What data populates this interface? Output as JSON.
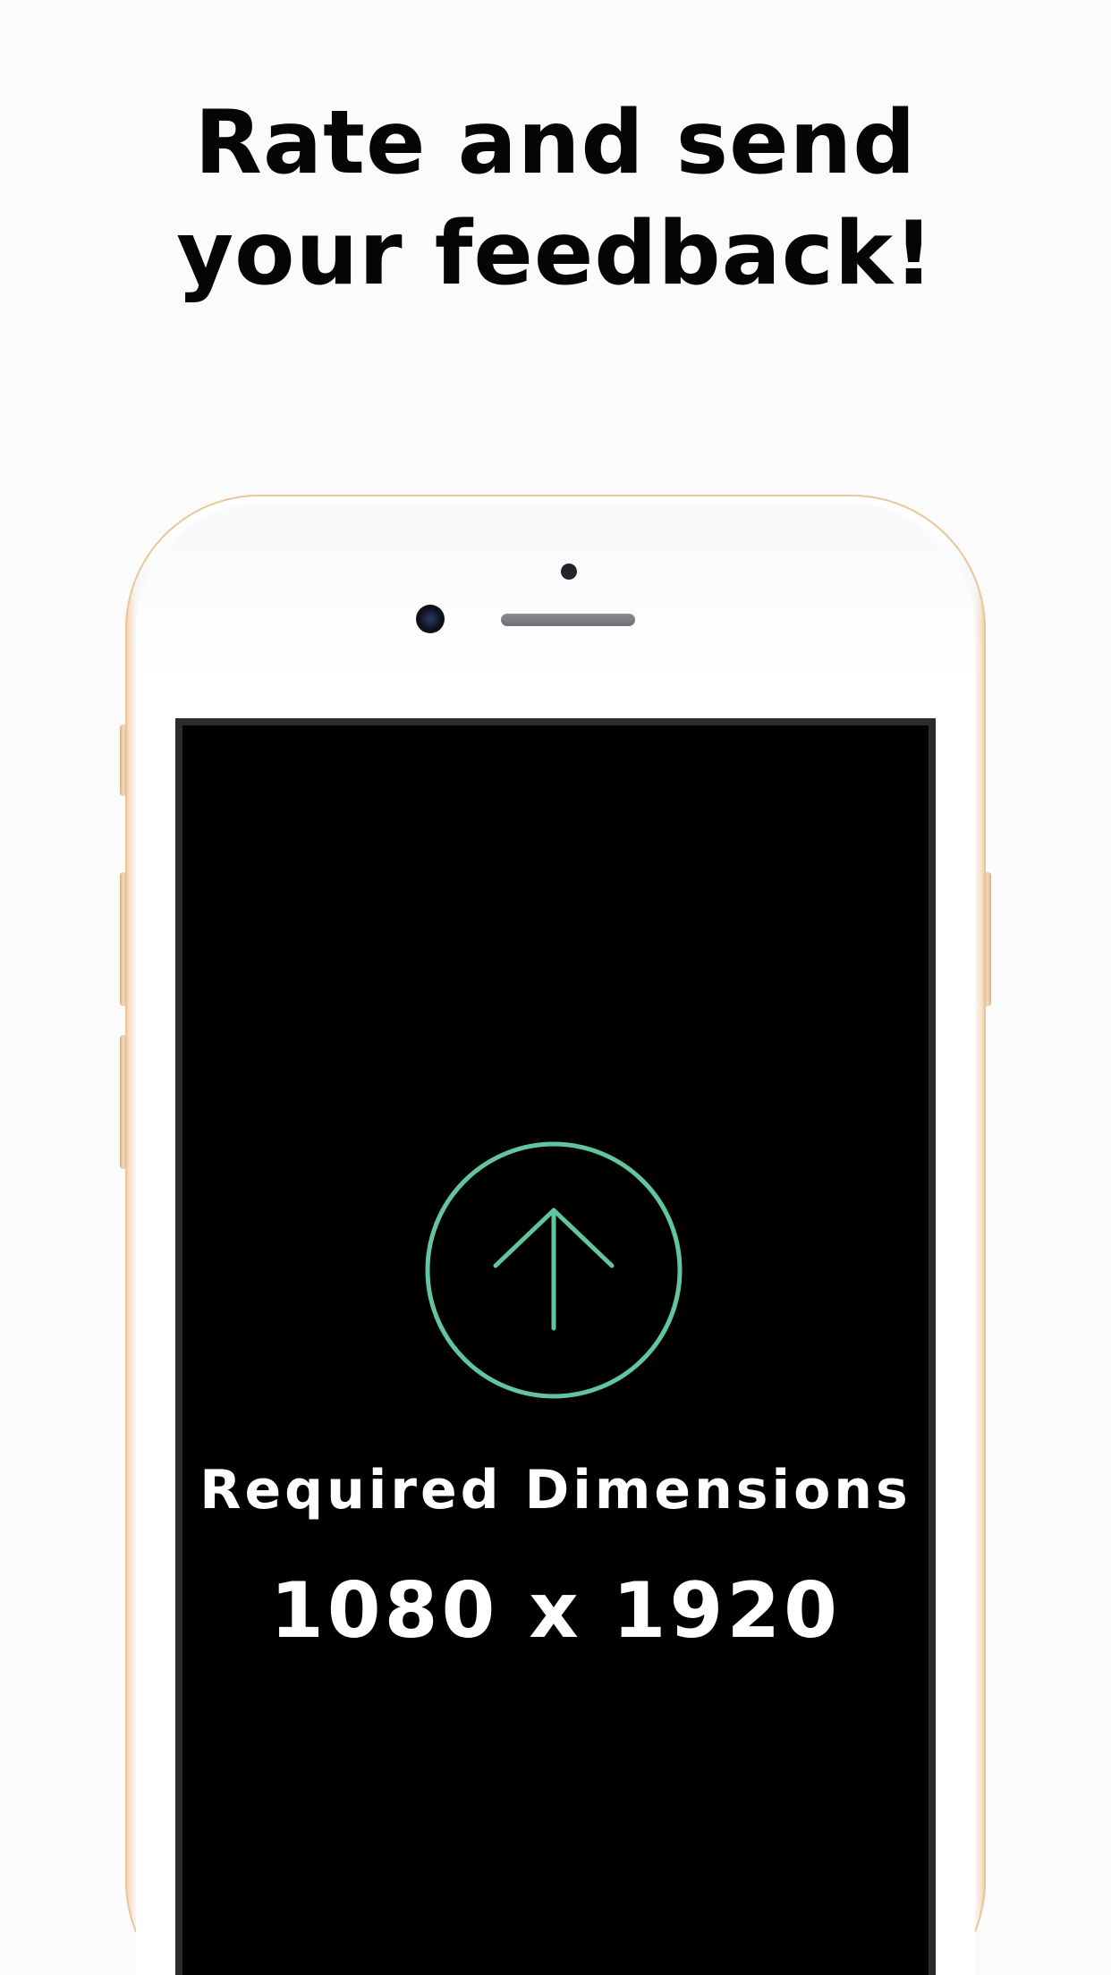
{
  "headline": {
    "line1": "Rate and send",
    "line2": "your feedback!"
  },
  "placeholder": {
    "label": "Required Dimensions",
    "dimensions": "1080 x 1920"
  },
  "icons": {
    "upload": "arrow-up-circle-icon"
  },
  "colors": {
    "background": "#fbfbfc",
    "accent": "#62c59e",
    "phone_frame": "#e3b788",
    "screen": "#000000",
    "text": "#050505"
  }
}
